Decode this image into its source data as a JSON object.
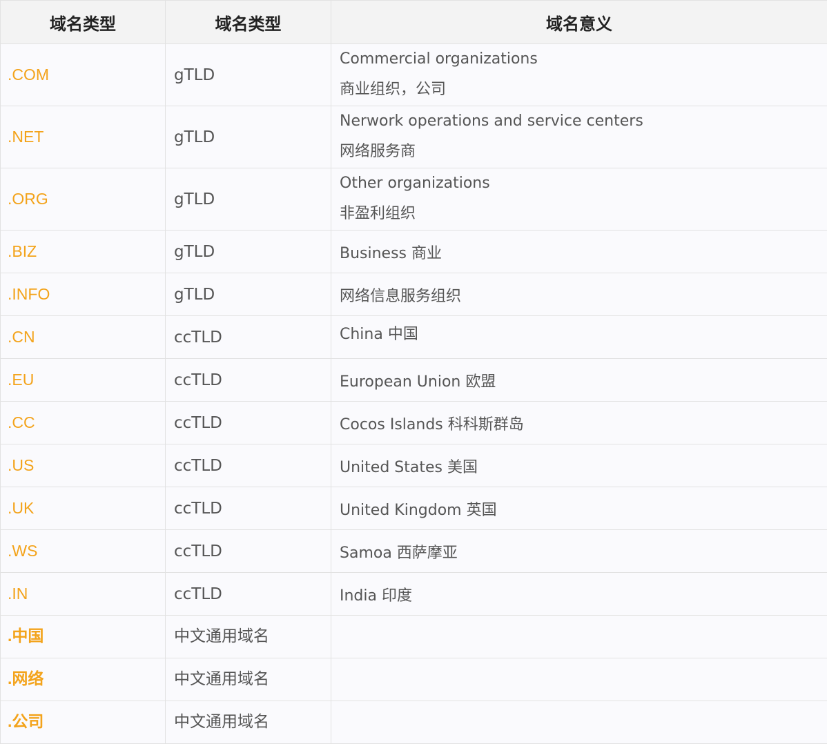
{
  "header": {
    "col1": "域名类型",
    "col2": "域名类型",
    "col3": "域名意义"
  },
  "rows": [
    {
      "domain": ".COM",
      "type": "gTLD",
      "meaning_en": "Commercial organizations",
      "meaning_zh": "商业组织，公司"
    },
    {
      "domain": ".NET",
      "type": "gTLD",
      "meaning_en": "Nerwork operations and service centers",
      "meaning_zh": "网络服务商"
    },
    {
      "domain": ".ORG",
      "type": "gTLD",
      "meaning_en": "Other organizations",
      "meaning_zh": "非盈利组织"
    },
    {
      "domain": ".BIZ",
      "type": "gTLD",
      "meaning": "Business 商业"
    },
    {
      "domain": ".INFO",
      "type": "gTLD",
      "meaning": "网络信息服务组织"
    },
    {
      "domain": ".CN",
      "type": "ccTLD",
      "meaning": "China 中国"
    },
    {
      "domain": ".EU",
      "type": "ccTLD",
      "meaning": "European Union 欧盟"
    },
    {
      "domain": ".CC",
      "type": "ccTLD",
      "meaning": "Cocos Islands 科科斯群岛"
    },
    {
      "domain": ".US",
      "type": "ccTLD",
      "meaning": "United States 美国"
    },
    {
      "domain": ".UK",
      "type": "ccTLD",
      "meaning": "United Kingdom 英国"
    },
    {
      "domain": ".WS",
      "type": "ccTLD",
      "meaning": "Samoa 西萨摩亚"
    },
    {
      "domain": ".IN",
      "type": "ccTLD",
      "meaning": "India 印度"
    },
    {
      "domain": ".中国",
      "type": "中文通用域名",
      "meaning": ""
    },
    {
      "domain": ".网络",
      "type": "中文通用域名",
      "meaning": ""
    },
    {
      "domain": ".公司",
      "type": "中文通用域名",
      "meaning": ""
    }
  ],
  "colors": {
    "domain_text": "#f3a31b",
    "body_text": "#555555",
    "header_bg": "#f3f3f3",
    "cell_bg": "#fafafd",
    "border": "#e2e2e2"
  }
}
